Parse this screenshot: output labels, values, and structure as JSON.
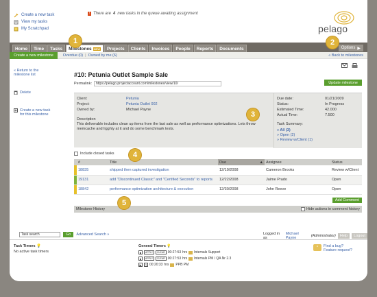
{
  "quick_links": [
    {
      "label": "Create a new task",
      "icon": "new-task-icon"
    },
    {
      "label": "View my tasks",
      "icon": "tasks-icon"
    },
    {
      "label": "My Scratchpad",
      "icon": "scratchpad-icon"
    }
  ],
  "notice": {
    "pre": "There are",
    "count": "4",
    "post": "new tasks in the queue awaiting assignment"
  },
  "logo": {
    "text": "pelago"
  },
  "nav": {
    "tabs": [
      "Home",
      "Time",
      "Tasks",
      "Milestones",
      "Projects",
      "Clients",
      "Invoices",
      "People",
      "Reports",
      "Documents"
    ],
    "active": "Milestones",
    "milestones_badge": "NEW",
    "options_label": "Options"
  },
  "subnav": {
    "create": "Create a new milestone",
    "overdue": "Overdue (0)",
    "owned": "Owned by me (6)",
    "back": "« Back to milestones"
  },
  "sidebar": {
    "return": "« Return to the milestone list",
    "delete": "Delete",
    "create_task": "Create a new task for this milestone"
  },
  "milestone": {
    "title": "#10: Petunia Outlet Sample Sale",
    "permalink_label": "Permalink:",
    "permalink": "https://pelago.projectaccount.com/milestones/view/10/",
    "update_button": "Update milestone",
    "client_label": "Client:",
    "client": "Petunia",
    "project_label": "Project:",
    "project": "Petunia Outlet 002",
    "owned_label": "Owned by:",
    "owner": "Michael Payne",
    "description_label": "Description",
    "description": "This deliverable includes clean up items from the last sale as well as performance optimizations. Lets throw memcache and ligghty at it and do some benchmark tests.",
    "due_label": "Due date:",
    "due": "01/21/2009",
    "status_label": "Status:",
    "status": "In Progress",
    "est_label": "Estimated Time:",
    "est": "42.000",
    "actual_label": "Actual Time:",
    "actual": "7.500",
    "summary_label": "Task Summary:",
    "summary_all": "» All (3)",
    "summary_open": "» Open (2)",
    "summary_review": "» Review w/Client (1)"
  },
  "include_closed": "Include closed tasks",
  "table": {
    "headers": [
      "#",
      "Title",
      "Due",
      "Assignee",
      "Status"
    ],
    "rows": [
      {
        "id": "18835",
        "title": "shipped then captured investigation",
        "due": "12/19/2008",
        "assignee": "Cameron Brooks",
        "status": "Review w/Client",
        "color": "#e6c02a"
      },
      {
        "id": "19131",
        "title": "add \"Discontinued Classic\" and \"Certified Seconds\" to reports",
        "due": "12/22/2008",
        "assignee": "Jaime Prado",
        "status": "Open",
        "color": "#7fb33a"
      },
      {
        "id": "18842",
        "title": "performance optimization architecture & execution",
        "due": "12/30/2008",
        "assignee": "John Reeve",
        "status": "Open",
        "color": "#e6c02a"
      }
    ]
  },
  "add_comment": "Add Comment",
  "history": {
    "label": "Milestone History",
    "hide": "Hide actions in comment history"
  },
  "search": {
    "placeholder": "Task search",
    "go": "Go",
    "advanced": "Advanced Search »"
  },
  "logged_in": {
    "pre": "Logged in as",
    "user": "Michael Payne",
    "role": "(Administrator)",
    "help": "Help",
    "logout": "Logout"
  },
  "task_timers": {
    "title": "Task Timers",
    "empty": "No active task timers"
  },
  "general_timers": {
    "title": "General Timers",
    "rows": [
      {
        "time": "00:27:53",
        "unit": "hrs",
        "label": "Internals Support"
      },
      {
        "time": "00:27:53",
        "unit": "hrs",
        "label": "Internals PM / QA Nr 2.3"
      },
      {
        "time": "00:20:33",
        "unit": "hrs",
        "label": "PPB PM"
      }
    ]
  },
  "bug": {
    "line1": "Find a bug?",
    "line2": "Feature request?"
  },
  "markers": [
    "1",
    "2",
    "3",
    "4",
    "5"
  ]
}
